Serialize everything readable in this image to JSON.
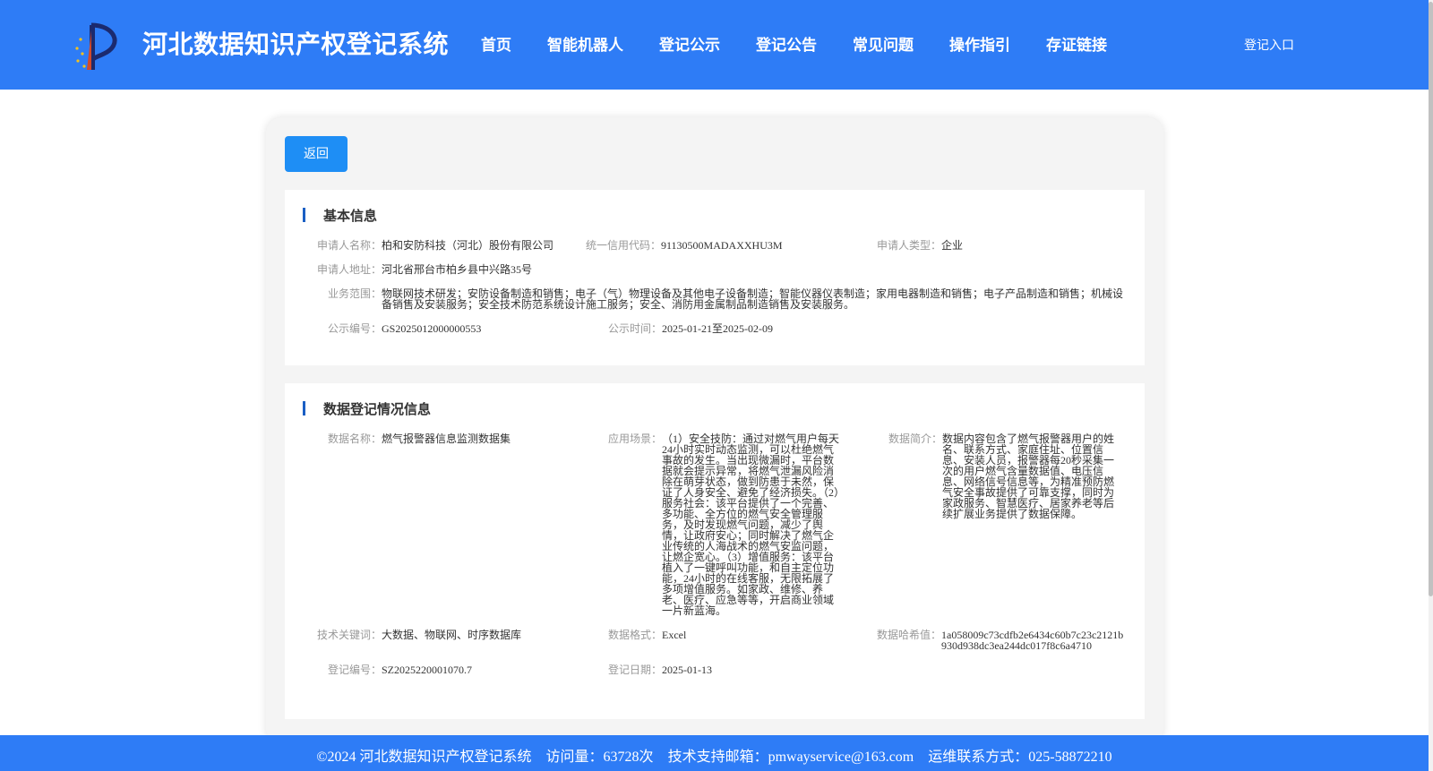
{
  "header": {
    "title": "河北数据知识产权登记系统",
    "nav": [
      "首页",
      "智能机器人",
      "登记公示",
      "登记公告",
      "常见问题",
      "操作指引",
      "存证链接"
    ],
    "login": "登记入口"
  },
  "actions": {
    "back": "返回"
  },
  "basic": {
    "title": "基本信息",
    "applicant_name_label": "申请人名称：",
    "applicant_name": "柏和安防科技（河北）股份有限公司",
    "credit_code_label": "统一信用代码：",
    "credit_code": "91130500MADAXXHU3M",
    "applicant_type_label": "申请人类型：",
    "applicant_type": "企业",
    "address_label": "申请人地址：",
    "address": "河北省邢台市柏乡县中兴路35号",
    "scope_label": "业务范围：",
    "scope": "物联网技术研发；安防设备制造和销售；电子（气）物理设备及其他电子设备制造；智能仪器仪表制造；家用电器制造和销售；电子产品制造和销售；机械设备销售及安装服务；安全技术防范系统设计施工服务；安全、消防用金属制品制造销售及安装服务。",
    "pub_no_label": "公示编号：",
    "pub_no": "GS2025012000000553",
    "pub_time_label": "公示时间：",
    "pub_time": "2025-01-21至2025-02-09"
  },
  "registration": {
    "title": "数据登记情况信息",
    "data_name_label": "数据名称：",
    "data_name": "燃气报警器信息监测数据集",
    "scenario_label": "应用场景：",
    "scenario": "（1）安全技防：通过对燃气用户每天24小时实时动态监测，可以杜绝燃气事故的发生。当出现微漏时，平台数据就会提示异常，将燃气泄漏风险消除在萌芽状态，做到防患于未然，保证了人身安全、避免了经济损失。（2）服务社会：该平台提供了一个完善、多功能、全方位的燃气安全管理服务，及时发现燃气问题，减少了舆情，让政府安心；同时解决了燃气企业传统的人海战术的燃气安监问题，让燃企宽心。（3）增值服务：该平台植入了一键呼叫功能，和自主定位功能，24小时的在线客服，无限拓展了多项增值服务。如家政、维修、养老、医疗、应急等等，开启商业领域一片新蓝海。",
    "intro_label": "数据简介：",
    "intro": "数据内容包含了燃气报警器用户的姓名、联系方式、家庭住址、位置信息、安装人员，报警器每20秒采集一次的用户燃气含量数据值、电压信息、网络信号信息等，为精准预防燃气安全事故提供了可靠支撑，同时为家政服务、智慧医疗、居家养老等后续扩展业务提供了数据保障。",
    "keywords_label": "技术关键词：",
    "keywords": "大数据、物联网、时序数据库",
    "format_label": "数据格式：",
    "format": "Excel",
    "hash_label": "数据哈希值：",
    "hash": "1a058009c73cdfb2e6434c60b7c23c2121b930d938dc3ea244dc017f8c6a4710",
    "reg_no_label": "登记编号：",
    "reg_no": "SZ2025220001070.7",
    "reg_date_label": "登记日期：",
    "reg_date": "2025-01-13"
  },
  "footer": {
    "copyright": "©2024 河北数据知识产权登记系统",
    "visits": "访问量：63728次",
    "email": "技术支持邮箱：pmwayservice@163.com",
    "phone": "运维联系方式：025-58872210"
  },
  "colors": {
    "brand": "#2e7cf6",
    "button": "#1e8ef5",
    "accent_bar": "#1a5fc4"
  }
}
